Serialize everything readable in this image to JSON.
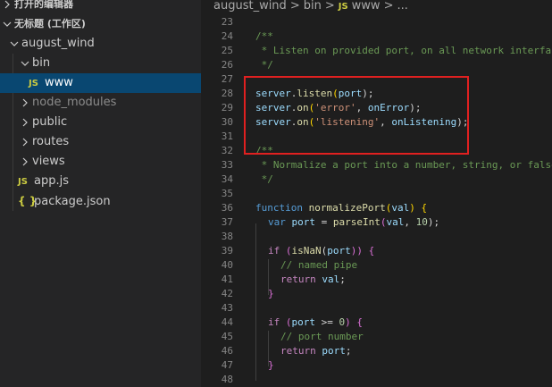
{
  "sidebar": {
    "open_editors": "打开的编辑器",
    "workspace": "无标题 (工作区)",
    "root_folder": "august_wind",
    "items": [
      {
        "label": "bin",
        "type": "folder",
        "expanded": true
      },
      {
        "label": "www",
        "type": "js",
        "selected": true
      },
      {
        "label": "node_modules",
        "type": "folder",
        "expanded": false
      },
      {
        "label": "public",
        "type": "folder",
        "expanded": false
      },
      {
        "label": "routes",
        "type": "folder",
        "expanded": false
      },
      {
        "label": "views",
        "type": "folder",
        "expanded": false
      },
      {
        "label": "app.js",
        "type": "js"
      },
      {
        "label": "package.json",
        "type": "json"
      }
    ],
    "js_badge": "JS",
    "json_badge": "{ }"
  },
  "breadcrumb": {
    "root": "august_wind",
    "folder": "bin",
    "file": "www",
    "more": "...",
    "sep": ">",
    "js_badge": "JS"
  },
  "code": {
    "line_numbers": [
      "23",
      "24",
      "25",
      "26",
      "27",
      "28",
      "29",
      "30",
      "31",
      "32",
      "33",
      "34",
      "35",
      "36",
      "37",
      "38",
      "39",
      "40",
      "41",
      "42",
      "43",
      "44",
      "45",
      "46",
      "47",
      "48"
    ],
    "l24": "/**",
    "l25": " * Listen on provided port, on all network interfaces.",
    "l26": " */",
    "l28_a": "server",
    "l28_b": ".",
    "l28_c": "listen",
    "l28_d": "(",
    "l28_e": "port",
    "l28_f": ");",
    "l29_a": "server",
    "l29_b": ".",
    "l29_c": "on",
    "l29_d": "(",
    "l29_e": "'error'",
    "l29_f": ", ",
    "l29_g": "onError",
    "l29_h": ");",
    "l30_a": "server",
    "l30_b": ".",
    "l30_c": "on",
    "l30_d": "(",
    "l30_e": "'listening'",
    "l30_f": ", ",
    "l30_g": "onListening",
    "l30_h": ");",
    "l32": "/**",
    "l33": " * Normalize a port into a number, string, or false.",
    "l34": " */",
    "l36_a": "function",
    "l36_b": " ",
    "l36_c": "normalizePort",
    "l36_d": "(",
    "l36_e": "val",
    "l36_f": ") {",
    "l37_a": "var",
    "l37_b": " ",
    "l37_c": "port",
    "l37_d": " = ",
    "l37_e": "parseInt",
    "l37_f": "(",
    "l37_g": "val",
    "l37_h": ", ",
    "l37_i": "10",
    "l37_j": ");",
    "l39_a": "if",
    "l39_b": " (",
    "l39_c": "isNaN",
    "l39_d": "(",
    "l39_e": "port",
    "l39_f": ")) {",
    "l40": "// named pipe",
    "l41_a": "return",
    "l41_b": " ",
    "l41_c": "val",
    "l41_d": ";",
    "l42": "}",
    "l44_a": "if",
    "l44_b": " (",
    "l44_c": "port",
    "l44_d": " >= ",
    "l44_e": "0",
    "l44_f": ") {",
    "l45": "// port number",
    "l46_a": "return",
    "l46_b": " ",
    "l46_c": "port",
    "l46_d": ";",
    "l47": "}"
  },
  "colors": {
    "highlight": "#e02020",
    "selection": "#094771",
    "comment": "#6a9955",
    "keyword": "#569cd6",
    "function": "#dcdcaa",
    "string": "#ce9178"
  }
}
